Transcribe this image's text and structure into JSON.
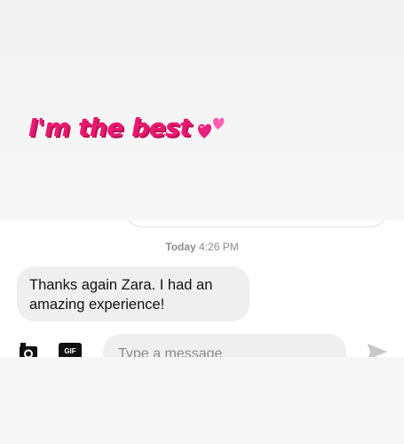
{
  "story": {
    "sticker_text": "I'm the best",
    "sticker_icon": "two-hearts-icon",
    "sticker_color": "#e8196f"
  },
  "thread": {
    "timestamp_day": "Today",
    "timestamp_time": "4:26 PM",
    "messages": [
      {
        "text": "Thanks again Zara. I had an amazing experience!"
      }
    ]
  },
  "composer": {
    "camera_icon": "camera-icon",
    "gif_label": "GIF",
    "placeholder": "Type a message",
    "send_icon": "send-icon"
  }
}
